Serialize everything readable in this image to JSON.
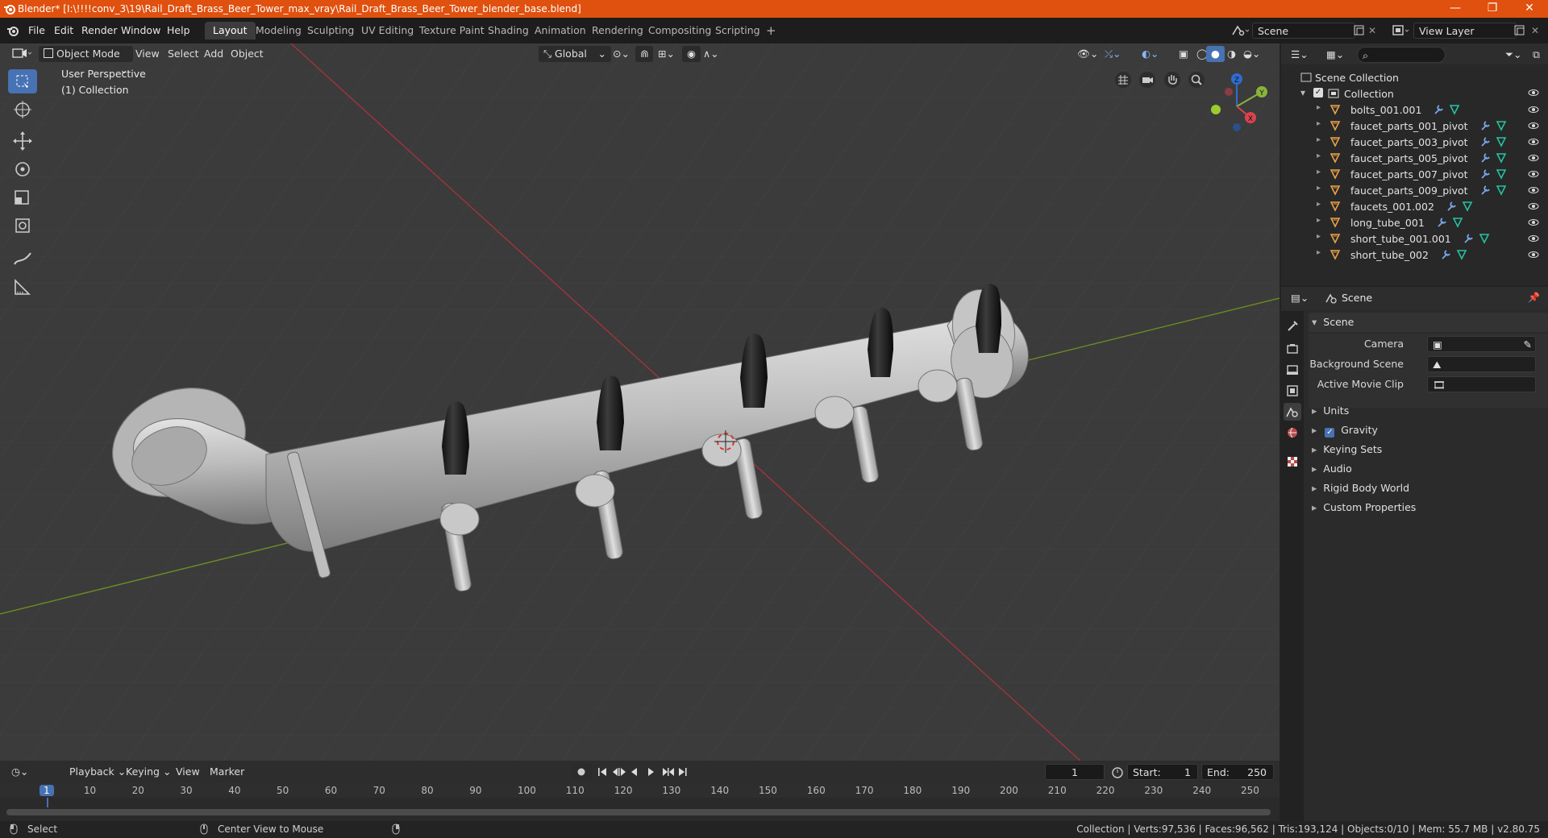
{
  "titlebar": {
    "title": "Blender* [I:\\!!!!conv_3\\19\\Rail_Draft_Brass_Beer_Tower_max_vray\\Rail_Draft_Brass_Beer_Tower_blender_base.blend]",
    "minimize": "—",
    "maximize": "❐",
    "close": "✕"
  },
  "menu": {
    "items": [
      "File",
      "Edit",
      "Render",
      "Window",
      "Help"
    ]
  },
  "workspaces": {
    "tabs": [
      "Layout",
      "Modeling",
      "Sculpting",
      "UV Editing",
      "Texture Paint",
      "Shading",
      "Animation",
      "Rendering",
      "Compositing",
      "Scripting"
    ],
    "active": "Layout",
    "add": "+"
  },
  "scene_selector": {
    "value": "Scene"
  },
  "viewlayer_selector": {
    "value": "View Layer"
  },
  "viewport_header": {
    "mode": "Object Mode",
    "menus": [
      "View",
      "Select",
      "Add",
      "Object"
    ],
    "orientation": "Global"
  },
  "viewport": {
    "perspective_label": "User Perspective",
    "collection_label": "(1) Collection",
    "gizmo": {
      "x": "X",
      "y": "Y",
      "z": "Z"
    }
  },
  "outliner": {
    "scene_collection": "Scene Collection",
    "collection": "Collection",
    "items": [
      "bolts_001.001",
      "faucet_parts_001_pivot",
      "faucet_parts_003_pivot",
      "faucet_parts_005_pivot",
      "faucet_parts_007_pivot",
      "faucet_parts_009_pivot",
      "faucets_001.002",
      "long_tube_001",
      "short_tube_001.001",
      "short_tube_002"
    ]
  },
  "properties": {
    "header": "Scene",
    "panel_title": "Scene",
    "camera_label": "Camera",
    "background_scene_label": "Background Scene",
    "active_movie_clip_label": "Active Movie Clip",
    "sections": [
      "Units",
      "Gravity",
      "Keying Sets",
      "Audio",
      "Rigid Body World",
      "Custom Properties"
    ],
    "gravity_checked": true
  },
  "timeline": {
    "menus": [
      "Playback",
      "Keying",
      "View",
      "Marker"
    ],
    "current_frame": "1",
    "start_label": "Start:",
    "start_value": "1",
    "end_label": "End:",
    "end_value": "250",
    "ruler": [
      "1",
      "10",
      "20",
      "30",
      "40",
      "50",
      "60",
      "70",
      "80",
      "90",
      "100",
      "110",
      "120",
      "130",
      "140",
      "150",
      "160",
      "170",
      "180",
      "190",
      "200",
      "210",
      "220",
      "230",
      "240",
      "250"
    ]
  },
  "statusbar": {
    "select": "Select",
    "center_view": "Center View to Mouse",
    "stats": "Collection | Verts:97,536 | Faces:96,562 | Tris:193,124 | Objects:0/10 | Mem: 55.7 MB | v2.80.75"
  },
  "colors": {
    "titlebar": "#e0500e",
    "accent": "#4772b3",
    "x_axis": "#c8414b",
    "y_axis": "#7ba12c",
    "object_icon": "#e8a14a",
    "mesh_icon": "#26c2a0"
  }
}
